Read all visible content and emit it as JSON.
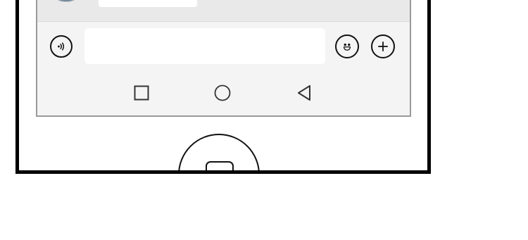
{
  "chat": {
    "avatar_name": "avatar",
    "bubble_text": ""
  },
  "input_bar": {
    "voice_icon": "voice-icon",
    "message_value": "",
    "message_placeholder": "",
    "emoji_icon": "emoji-icon",
    "plus_icon": "plus-icon"
  },
  "nav_bar": {
    "recent_icon": "square-icon",
    "home_icon": "circle-icon",
    "back_icon": "triangle-back-icon"
  },
  "device": {
    "home_button_icon": "home-button-icon"
  },
  "colors": {
    "screen_bg": "#f4f4f4",
    "message_area_bg": "#e9e9e9",
    "input_bg": "#ffffff",
    "frame": "#000000"
  }
}
